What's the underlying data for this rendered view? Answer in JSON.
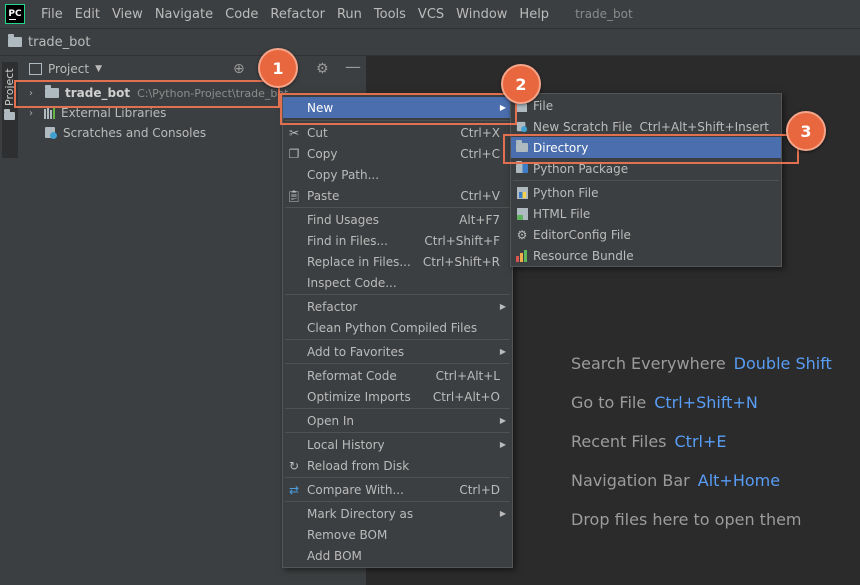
{
  "app": {
    "logo_text": "PC",
    "menu": [
      "File",
      "Edit",
      "View",
      "Navigate",
      "Code",
      "Refactor",
      "Run",
      "Tools",
      "VCS",
      "Window",
      "Help"
    ],
    "window_title": "trade_bot"
  },
  "breadcrumb": {
    "project": "trade_bot"
  },
  "tool_window": {
    "side_tab": "Project",
    "header_title": "Project"
  },
  "tree": {
    "root": {
      "name": "trade_bot",
      "path": "C:\\Python-Project\\trade_bot"
    },
    "external_libraries": "External Libraries",
    "scratches": "Scratches and Consoles"
  },
  "context_menu": {
    "new": "New",
    "cut": "Cut",
    "cut_sc": "Ctrl+X",
    "copy": "Copy",
    "copy_sc": "Ctrl+C",
    "copy_path": "Copy Path...",
    "paste": "Paste",
    "paste_sc": "Ctrl+V",
    "find_usages": "Find Usages",
    "find_usages_sc": "Alt+F7",
    "find_in_files": "Find in Files...",
    "find_in_files_sc": "Ctrl+Shift+F",
    "replace_in_files": "Replace in Files...",
    "replace_in_files_sc": "Ctrl+Shift+R",
    "inspect_code": "Inspect Code...",
    "refactor": "Refactor",
    "clean_compiled": "Clean Python Compiled Files",
    "add_favorites": "Add to Favorites",
    "reformat": "Reformat Code",
    "reformat_sc": "Ctrl+Alt+L",
    "optimize": "Optimize Imports",
    "optimize_sc": "Ctrl+Alt+O",
    "open_in": "Open In",
    "local_history": "Local History",
    "reload": "Reload from Disk",
    "compare": "Compare With...",
    "compare_sc": "Ctrl+D",
    "mark_dir": "Mark Directory as",
    "remove_bom": "Remove BOM",
    "add_bom": "Add BOM"
  },
  "new_submenu": {
    "file": "File",
    "scratch": "New Scratch File",
    "scratch_sc": "Ctrl+Alt+Shift+Insert",
    "directory": "Directory",
    "python_package": "Python Package",
    "python_file": "Python File",
    "html_file": "HTML File",
    "editorconfig": "EditorConfig File",
    "resource_bundle": "Resource Bundle"
  },
  "editor_hints": [
    {
      "label": "Search Everywhere",
      "key": "Double Shift"
    },
    {
      "label": "Go to File",
      "key": "Ctrl+Shift+N"
    },
    {
      "label": "Recent Files",
      "key": "Ctrl+E"
    },
    {
      "label": "Navigation Bar",
      "key": "Alt+Home"
    },
    {
      "label": "Drop files here to open them",
      "key": ""
    }
  ],
  "callouts": [
    "1",
    "2",
    "3"
  ],
  "colors": {
    "highlight": "#4b6eaf",
    "callout": "#e8673e",
    "link": "#589df6"
  }
}
